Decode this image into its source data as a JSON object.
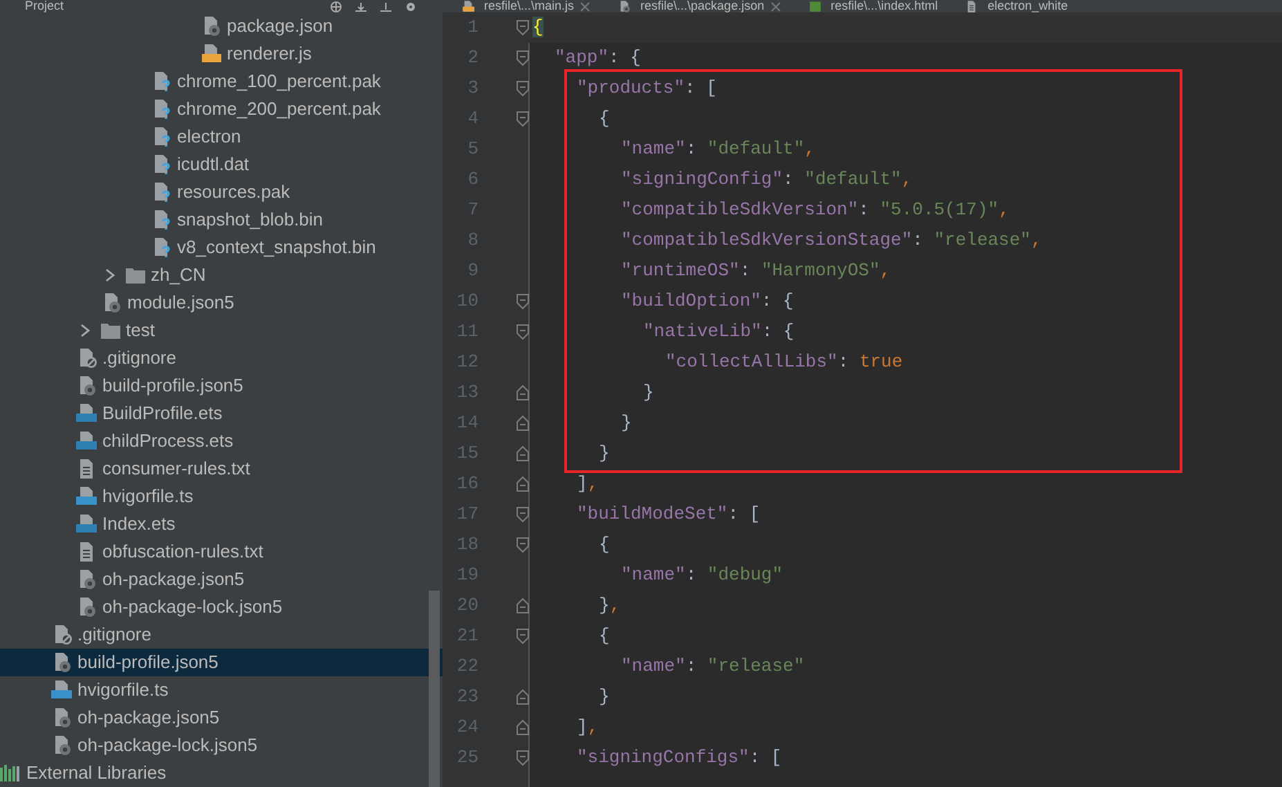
{
  "project_panel": {
    "title": "Project",
    "tree": [
      {
        "children": [
          {
            "children": [
              {
                "children": [
                  {
                    "children": [
                      {
                        "children": [
                          {
                            "children": [
                              {
                                "children": [
                                  {
                                    "children": [
                                      {
                                        "label": "package.json",
                                        "kind": "json",
                                        "selected": false
                                      },
                                      {
                                        "label": "renderer.js",
                                        "kind": "js",
                                        "selected": false
                                      }
                                    ]
                                  }
                                ]
                              },
                              {
                                "label": "chrome_100_percent.pak",
                                "kind": "unknown",
                                "selected": false
                              },
                              {
                                "label": "chrome_200_percent.pak",
                                "kind": "unknown",
                                "selected": false
                              },
                              {
                                "label": "electron",
                                "kind": "unknown",
                                "selected": false
                              },
                              {
                                "label": "icudtl.dat",
                                "kind": "unknown",
                                "selected": false
                              },
                              {
                                "label": "resources.pak",
                                "kind": "unknown",
                                "selected": false
                              },
                              {
                                "label": "snapshot_blob.bin",
                                "kind": "unknown",
                                "selected": false
                              },
                              {
                                "label": "v8_context_snapshot.bin",
                                "kind": "unknown",
                                "selected": false
                              }
                            ]
                          }
                        ]
                      },
                      {
                        "label": "zh_CN",
                        "kind": "folder",
                        "expanded": false,
                        "selected": false
                      },
                      {
                        "label": "module.json5",
                        "kind": "json",
                        "selected": false
                      }
                    ]
                  },
                  {
                    "label": "test",
                    "kind": "folder",
                    "expanded": false,
                    "selected": false
                  },
                  {
                    "label": ".gitignore",
                    "kind": "ignore",
                    "selected": false
                  },
                  {
                    "label": "build-profile.json5",
                    "kind": "json",
                    "selected": false
                  },
                  {
                    "label": "BuildProfile.ets",
                    "kind": "ets",
                    "selected": false
                  },
                  {
                    "label": "childProcess.ets",
                    "kind": "ets",
                    "selected": false
                  },
                  {
                    "label": "consumer-rules.txt",
                    "kind": "text",
                    "selected": false
                  },
                  {
                    "label": "hvigorfile.ts",
                    "kind": "ts",
                    "selected": false
                  },
                  {
                    "label": "Index.ets",
                    "kind": "ets",
                    "selected": false
                  },
                  {
                    "label": "obfuscation-rules.txt",
                    "kind": "text",
                    "selected": false
                  },
                  {
                    "label": "oh-package.json5",
                    "kind": "json",
                    "selected": false
                  },
                  {
                    "label": "oh-package-lock.json5",
                    "kind": "json",
                    "selected": false
                  }
                ]
              },
              {
                "label": ".gitignore",
                "kind": "ignore",
                "selected": false
              },
              {
                "label": "build-profile.json5",
                "kind": "json",
                "selected": true
              },
              {
                "label": "hvigorfile.ts",
                "kind": "ts",
                "selected": false
              },
              {
                "label": "oh-package.json5",
                "kind": "json",
                "selected": false
              },
              {
                "label": "oh-package-lock.json5",
                "kind": "json",
                "selected": false
              }
            ]
          }
        ]
      },
      {
        "label": "External Libraries",
        "kind": "libraries",
        "selected": false
      }
    ]
  },
  "editor": {
    "tabs": [
      {
        "label": "resfile\\...\\main.js",
        "kind": "js",
        "closable": true,
        "selected": false
      },
      {
        "label": "resfile\\...\\package.json",
        "kind": "json",
        "closable": true,
        "selected": false
      },
      {
        "label": "resfile\\...\\index.html",
        "kind": "html",
        "closable": false,
        "selected": false
      },
      {
        "label": "electron_white",
        "kind": "text",
        "closable": false,
        "selected": false
      }
    ],
    "blocks": [
      {
        "kind": "plain",
        "lines": [
          {
            "number": "1",
            "current": true,
            "kind": "fold_start",
            "tokens": [
              {
                "kind": "brace_match",
                "text": "{"
              }
            ]
          },
          {
            "number": "2",
            "current": false,
            "kind": "fold_start",
            "tokens": [
              {
                "kind": "key",
                "text": "\"app\""
              },
              {
                "kind": "punct",
                "text": ": {"
              }
            ]
          }
        ]
      },
      {
        "kind": "highlighted",
        "lines": [
          {
            "number": "3",
            "current": false,
            "kind": "fold_start",
            "tokens": [
              {
                "kind": "key",
                "text": "\"products\""
              },
              {
                "kind": "punct",
                "text": ": ["
              }
            ]
          },
          {
            "number": "4",
            "current": false,
            "kind": "fold_start",
            "tokens": [
              {
                "kind": "punct",
                "text": "{"
              }
            ]
          },
          {
            "number": "5",
            "current": false,
            "kind": "plain",
            "tokens": [
              {
                "kind": "key",
                "text": "\"name\""
              },
              {
                "kind": "punct",
                "text": ": "
              },
              {
                "kind": "string",
                "text": "\"default\""
              },
              {
                "kind": "comma",
                "text": ","
              }
            ]
          },
          {
            "number": "6",
            "current": false,
            "kind": "plain",
            "tokens": [
              {
                "kind": "key",
                "text": "\"signingConfig\""
              },
              {
                "kind": "punct",
                "text": ": "
              },
              {
                "kind": "string",
                "text": "\"default\""
              },
              {
                "kind": "comma",
                "text": ","
              }
            ]
          },
          {
            "number": "7",
            "current": false,
            "kind": "plain",
            "tokens": [
              {
                "kind": "key",
                "text": "\"compatibleSdkVersion\""
              },
              {
                "kind": "punct",
                "text": ": "
              },
              {
                "kind": "string",
                "text": "\"5.0.5(17)\""
              },
              {
                "kind": "comma",
                "text": ","
              }
            ]
          },
          {
            "number": "8",
            "current": false,
            "kind": "plain",
            "tokens": [
              {
                "kind": "key",
                "text": "\"compatibleSdkVersionStage\""
              },
              {
                "kind": "punct",
                "text": ": "
              },
              {
                "kind": "string",
                "text": "\"release\""
              },
              {
                "kind": "comma",
                "text": ","
              }
            ]
          },
          {
            "number": "9",
            "current": false,
            "kind": "plain",
            "tokens": [
              {
                "kind": "key",
                "text": "\"runtimeOS\""
              },
              {
                "kind": "punct",
                "text": ": "
              },
              {
                "kind": "string",
                "text": "\"HarmonyOS\""
              },
              {
                "kind": "comma",
                "text": ","
              }
            ]
          },
          {
            "number": "10",
            "current": false,
            "kind": "fold_start",
            "tokens": [
              {
                "kind": "key",
                "text": "\"buildOption\""
              },
              {
                "kind": "punct",
                "text": ": {"
              }
            ]
          },
          {
            "number": "11",
            "current": false,
            "kind": "fold_start",
            "tokens": [
              {
                "kind": "key",
                "text": "\"nativeLib\""
              },
              {
                "kind": "punct",
                "text": ": {"
              }
            ]
          },
          {
            "number": "12",
            "current": false,
            "kind": "plain",
            "tokens": [
              {
                "kind": "key",
                "text": "\"collectAllLibs\""
              },
              {
                "kind": "punct",
                "text": ": "
              },
              {
                "kind": "literal",
                "text": "true"
              }
            ]
          },
          {
            "number": "13",
            "current": false,
            "kind": "fold_end",
            "tokens": [
              {
                "kind": "punct",
                "text": "}"
              }
            ]
          },
          {
            "number": "14",
            "current": false,
            "kind": "fold_end",
            "tokens": [
              {
                "kind": "punct",
                "text": "}"
              }
            ]
          },
          {
            "number": "15",
            "current": false,
            "kind": "fold_end",
            "tokens": [
              {
                "kind": "punct",
                "text": "}"
              }
            ]
          }
        ]
      },
      {
        "kind": "plain",
        "lines": [
          {
            "number": "16",
            "current": false,
            "kind": "fold_end",
            "tokens": [
              {
                "kind": "punct",
                "text": "]"
              },
              {
                "kind": "comma",
                "text": ","
              }
            ]
          },
          {
            "number": "17",
            "current": false,
            "kind": "fold_start",
            "tokens": [
              {
                "kind": "key",
                "text": "\"buildModeSet\""
              },
              {
                "kind": "punct",
                "text": ": ["
              }
            ]
          },
          {
            "number": "18",
            "current": false,
            "kind": "fold_start",
            "tokens": [
              {
                "kind": "punct",
                "text": "{"
              }
            ]
          },
          {
            "number": "19",
            "current": false,
            "kind": "plain",
            "tokens": [
              {
                "kind": "key",
                "text": "\"name\""
              },
              {
                "kind": "punct",
                "text": ": "
              },
              {
                "kind": "string",
                "text": "\"debug\""
              }
            ]
          },
          {
            "number": "20",
            "current": false,
            "kind": "fold_end",
            "tokens": [
              {
                "kind": "punct",
                "text": "}"
              },
              {
                "kind": "comma",
                "text": ","
              }
            ]
          },
          {
            "number": "21",
            "current": false,
            "kind": "fold_start",
            "tokens": [
              {
                "kind": "punct",
                "text": "{"
              }
            ]
          },
          {
            "number": "22",
            "current": false,
            "kind": "plain",
            "tokens": [
              {
                "kind": "key",
                "text": "\"name\""
              },
              {
                "kind": "punct",
                "text": ": "
              },
              {
                "kind": "string",
                "text": "\"release\""
              }
            ]
          },
          {
            "number": "23",
            "current": false,
            "kind": "fold_end",
            "tokens": [
              {
                "kind": "punct",
                "text": "}"
              }
            ]
          },
          {
            "number": "24",
            "current": false,
            "kind": "fold_end",
            "tokens": [
              {
                "kind": "punct",
                "text": "]"
              },
              {
                "kind": "comma",
                "text": ","
              }
            ]
          },
          {
            "number": "25",
            "current": false,
            "kind": "fold_start",
            "tokens": [
              {
                "kind": "key",
                "text": "\"signingConfigs\""
              },
              {
                "kind": "punct",
                "text": ": ["
              }
            ]
          }
        ]
      }
    ]
  }
}
